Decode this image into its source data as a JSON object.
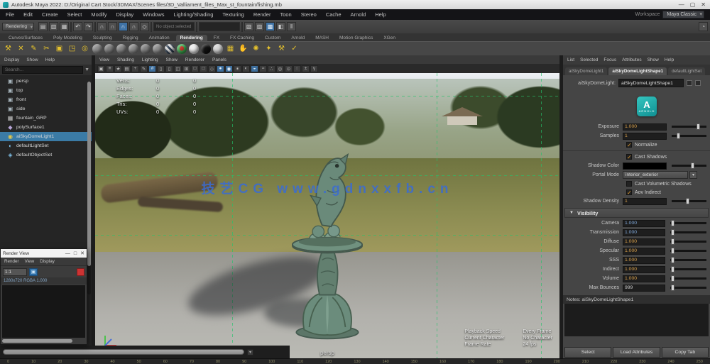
{
  "window": {
    "title": "Autodesk Maya 2022: D:/Original Cart Stock/3DMAX/Scenes files/3D_Valliament_files_Max_st_fountain/fishing.mb",
    "minimize": "—",
    "maximize": "▢",
    "close": "✕"
  },
  "menu_bar": {
    "items": [
      {
        "label": "File"
      },
      {
        "label": "Edit"
      },
      {
        "label": "Create"
      },
      {
        "label": "Select"
      },
      {
        "label": "Modify"
      },
      {
        "label": "Display"
      },
      {
        "label": "Windows"
      },
      {
        "label": "Lighting/Shading"
      },
      {
        "label": "Texturing"
      },
      {
        "label": "Render"
      },
      {
        "label": "Toon"
      },
      {
        "label": "Stereo"
      },
      {
        "label": "Cache"
      },
      {
        "label": "Arnold"
      },
      {
        "label": "Help"
      }
    ],
    "workspace_label": "Workspace",
    "workspace_value": "Maya Classic"
  },
  "status_line": {
    "menu_set": "Rendering",
    "icons": [
      {
        "name": "new-scene-icon",
        "glyph": "▤"
      },
      {
        "name": "open-scene-icon",
        "glyph": "▥"
      },
      {
        "name": "save-scene-icon",
        "glyph": "▦"
      },
      {
        "name": "divider",
        "glyph": "",
        "cls": "divider"
      },
      {
        "name": "undo-icon",
        "glyph": "↶"
      },
      {
        "name": "redo-icon",
        "glyph": "↷"
      },
      {
        "name": "divider",
        "glyph": "",
        "cls": "divider"
      },
      {
        "name": "snap-to-grid-icon",
        "glyph": "∩"
      },
      {
        "name": "snap-to-curve-icon",
        "glyph": "∩"
      },
      {
        "name": "snap-to-point-icon",
        "glyph": "∩",
        "cls": "active"
      },
      {
        "name": "snap-to-plane-icon",
        "glyph": "∩"
      },
      {
        "name": "make-live-icon",
        "glyph": "◇"
      },
      {
        "name": "divider",
        "glyph": "",
        "cls": "divider"
      },
      {
        "name": "input-operations-field",
        "glyph": "No object selected",
        "cls": "field"
      },
      {
        "name": "divider",
        "glyph": "",
        "cls": "divider"
      },
      {
        "name": "output-operations-field",
        "glyph": "",
        "cls": "field"
      },
      {
        "name": "divider",
        "glyph": "",
        "cls": "divider"
      },
      {
        "name": "render-frame-icon",
        "glyph": "▧"
      },
      {
        "name": "ipr-render-icon",
        "glyph": "▨"
      },
      {
        "name": "render-settings-icon",
        "glyph": "▩",
        "cls": "active"
      },
      {
        "name": "display-layers-icon",
        "glyph": "◧"
      },
      {
        "name": "pause-icon",
        "glyph": "‖"
      },
      {
        "name": "spacer",
        "glyph": "",
        "cls": "spacer"
      },
      {
        "name": "sitter-icon",
        "glyph": "◔"
      }
    ]
  },
  "shelf": {
    "tabs": [
      {
        "label": "Curves/Surfaces"
      },
      {
        "label": "Poly Modeling"
      },
      {
        "label": "Sculpting"
      },
      {
        "label": "Rigging"
      },
      {
        "label": "Animation"
      },
      {
        "label": "Rendering",
        "cls": "active"
      },
      {
        "label": "FX"
      },
      {
        "label": "FX Caching"
      },
      {
        "label": "Custom"
      },
      {
        "label": "Arnold"
      },
      {
        "label": "MASH"
      },
      {
        "label": "Motion Graphics"
      },
      {
        "label": "XGen"
      }
    ],
    "icons": [
      {
        "name": "hypershade-icon",
        "glyph": "⚒",
        "cls": "glyph"
      },
      {
        "name": "node-editor-icon",
        "glyph": "✕",
        "cls": "glyph"
      },
      {
        "name": "shading-group-icon",
        "glyph": "✎",
        "cls": "glyph"
      },
      {
        "name": "uv-editor-icon",
        "glyph": "✂",
        "cls": "glyph"
      },
      {
        "name": "material-viewer-icon",
        "glyph": "▣",
        "cls": "glyph"
      },
      {
        "name": "texture-tool-icon",
        "glyph": "◳",
        "cls": "glyph"
      },
      {
        "name": "wrap-tool-icon",
        "glyph": "◎",
        "cls": "glyph"
      },
      {
        "name": "standard-surface-icon",
        "cls": "sphere",
        "style": "background:#8d8d8d"
      },
      {
        "name": "blinn-icon",
        "cls": "sphere",
        "style": "background:#7f7f7f"
      },
      {
        "name": "lambert-icon",
        "cls": "sphere",
        "style": "background:#868686"
      },
      {
        "name": "phong-icon",
        "cls": "sphere",
        "style": "background:#8a8a8a"
      },
      {
        "name": "phonge-icon",
        "cls": "sphere",
        "style": "background:#828282"
      },
      {
        "name": "anisotropic-icon",
        "cls": "sphere",
        "style": "background:#8f8f8f"
      },
      {
        "name": "ramp-shader-icon",
        "cls": "sphere",
        "style": "background:repeating-linear-gradient(45deg,#d8d8d8 0 3px,#2e3e52 3px 6px)"
      },
      {
        "name": "ai-standard-surface-icon",
        "cls": "sphere",
        "style": "background:radial-gradient(circle at 50% 45%,#c03a2e 0 30%,#3faf52 32%)"
      },
      {
        "name": "surface-shader-icon",
        "cls": "sphere",
        "style": "background:#ededed"
      },
      {
        "name": "shadow-matte-icon",
        "cls": "sphere",
        "style": "background:#111"
      },
      {
        "name": "ai-mix-shader-icon",
        "cls": "sphere",
        "style": "background:#d6d6d6"
      },
      {
        "name": "ai-standard-volume-icon",
        "glyph": "▦",
        "cls": "glyph"
      },
      {
        "name": "assign-material-icon",
        "glyph": "✋",
        "cls": "glyph"
      },
      {
        "name": "point-light-icon",
        "glyph": "✺",
        "cls": "glyph"
      },
      {
        "name": "spot-light-icon",
        "glyph": "✦",
        "cls": "glyph"
      },
      {
        "name": "area-light-icon",
        "glyph": "⚒",
        "cls": "glyph"
      },
      {
        "name": "render-view-icon",
        "glyph": "✓",
        "cls": "glyph"
      }
    ]
  },
  "outliner": {
    "menus": [
      {
        "label": "Display"
      },
      {
        "label": "Show"
      },
      {
        "label": "Help"
      }
    ],
    "search_placeholder": "Search...",
    "items": [
      {
        "g": "▣",
        "ic": "cam",
        "label": "persp"
      },
      {
        "g": "▣",
        "ic": "cam",
        "label": "top"
      },
      {
        "g": "▣",
        "ic": "cam",
        "label": "front"
      },
      {
        "g": "▣",
        "ic": "cam",
        "label": "side"
      },
      {
        "g": "▦",
        "ic": "grp",
        "label": "fountain_GRP"
      },
      {
        "g": "◆",
        "ic": "mesh",
        "label": "polySurface1"
      },
      {
        "g": "◉",
        "ic": "light",
        "label": "aiSkyDomeLight1",
        "cls": "selected"
      },
      {
        "g": "◐",
        "ic": "set",
        "label": "defaultLightSet"
      },
      {
        "g": "◈",
        "ic": "set",
        "label": "defaultObjectSet"
      }
    ]
  },
  "render_view": {
    "title": "Render View",
    "controls": {
      "minimize": "—",
      "maximize": "□",
      "close": "✕"
    },
    "menus": [
      {
        "label": "Render"
      },
      {
        "label": "View"
      },
      {
        "label": "Display"
      }
    ],
    "zoom_value": "1:1",
    "info": "1280x720  RGBA  1.000"
  },
  "viewport": {
    "menus": [
      {
        "label": "View"
      },
      {
        "label": "Shading"
      },
      {
        "label": "Lighting"
      },
      {
        "label": "Show"
      },
      {
        "label": "Renderer"
      },
      {
        "label": "Panels"
      }
    ],
    "toolbar_icons": [
      {
        "name": "select-camera-icon",
        "glyph": "▣"
      },
      {
        "name": "camera-attributes-icon",
        "glyph": "≡"
      },
      {
        "name": "bookmark-icon",
        "glyph": "★"
      },
      {
        "name": "image-plane-icon",
        "glyph": "▤"
      },
      {
        "name": "2d-pan-zoom-icon",
        "glyph": "+"
      },
      {
        "name": "grease-pencil-icon",
        "glyph": "✎"
      },
      {
        "name": "grid-icon",
        "glyph": "#",
        "cls": "active"
      },
      {
        "name": "film-gate-icon",
        "glyph": "▯"
      },
      {
        "name": "resolution-gate-icon",
        "glyph": "▯"
      },
      {
        "name": "gate-mask-icon",
        "glyph": "◫"
      },
      {
        "name": "field-chart-icon",
        "glyph": "⊞"
      },
      {
        "name": "safe-action-icon",
        "glyph": "□"
      },
      {
        "name": "safe-title-icon",
        "glyph": "□"
      },
      {
        "name": "wireframe-icon",
        "glyph": "◇"
      },
      {
        "name": "shaded-icon",
        "glyph": "●",
        "cls": "active"
      },
      {
        "name": "textured-icon",
        "glyph": "◉",
        "cls": "active"
      },
      {
        "name": "use-all-lights-icon",
        "glyph": "✶"
      },
      {
        "name": "shadows-icon",
        "glyph": "◐"
      },
      {
        "name": "screen-space-ao-icon",
        "glyph": "◒",
        "cls": "active"
      },
      {
        "name": "motion-blur-icon",
        "glyph": "≈"
      },
      {
        "name": "multisample-icon",
        "glyph": "∴"
      },
      {
        "name": "depth-of-field-icon",
        "glyph": "◎"
      },
      {
        "name": "isolate-select-icon",
        "glyph": "⊙"
      },
      {
        "name": "xray-icon",
        "glyph": "◌"
      },
      {
        "name": "exposure-icon",
        "glyph": "±"
      },
      {
        "name": "gamma-icon",
        "glyph": "γ"
      }
    ],
    "hud_poly": [
      {
        "label": "Verts:",
        "total": "0",
        "sel": "0"
      },
      {
        "label": "Edges:",
        "total": "0",
        "sel": "0"
      },
      {
        "label": "Faces:",
        "total": "0",
        "sel": "0"
      },
      {
        "label": "Tris:",
        "total": "0",
        "sel": "0"
      },
      {
        "label": "UVs:",
        "total": "0",
        "sel": "0"
      }
    ],
    "watermark": "技艺CG  www.gdnxxfb.cn",
    "hud_bottom": [
      {
        "k": "Playback Speed",
        "v": "Every Frame"
      },
      {
        "k": "Current Character",
        "v": "No Character"
      },
      {
        "k": "Frame Rate",
        "v": "24 fps"
      }
    ],
    "camera_label": "persp"
  },
  "ae": {
    "menus": [
      {
        "label": "List"
      },
      {
        "label": "Selected"
      },
      {
        "label": "Focus"
      },
      {
        "label": "Attributes"
      },
      {
        "label": "Show"
      },
      {
        "label": "Help"
      }
    ],
    "tabs": [
      {
        "label": "aiSkyDomeLight1"
      },
      {
        "label": "aiSkyDomeLightShape1",
        "cls": "active"
      },
      {
        "label": "defaultLightSet"
      }
    ],
    "name_label": "aiSkyDomeLight:",
    "name_value": "aiSkyDomeLightShape1",
    "arnold_letter": "A",
    "arnold_sub": "ARNOLD",
    "rows": {
      "exposure_label": "Exposure",
      "exposure_value": "1.000",
      "samples_label": "Samples",
      "samples_value": "1",
      "normalize_label": "Normalize",
      "cast_shadows_label": "Cast Shadows",
      "shadow_color_label": "Shadow Color",
      "portal_mode_label": "Portal Mode",
      "portal_mode_value": "interior_exterior",
      "cast_vol_label": "Cast Volumetric Shadows",
      "aov_indirect_label": "Aov Indirect",
      "shadow_density_label": "Shadow Density",
      "shadow_density_value": "1",
      "check_glyph": "✓"
    },
    "visibility": {
      "header": "Visibility",
      "rows": [
        {
          "label": "Camera",
          "value": "1.000",
          "tone": "tblue"
        },
        {
          "label": "Transmission",
          "value": "1.000",
          "tone": "tblue"
        },
        {
          "label": "Diffuse",
          "value": "1.000",
          "tone": "torange"
        },
        {
          "label": "Specular",
          "value": "1.000",
          "tone": "torange"
        },
        {
          "label": "SSS",
          "value": "1.000",
          "tone": "torange"
        },
        {
          "label": "Indirect",
          "value": "1.000",
          "tone": "torange"
        },
        {
          "label": "Volume",
          "value": "1.000",
          "tone": "torange"
        },
        {
          "label": "Max Bounces",
          "value": "999",
          "tone": "tgray"
        }
      ]
    },
    "notes_header": "Notes: aiSkyDomeLightShape1",
    "buttons": [
      {
        "label": "Select"
      },
      {
        "label": "Load Attributes"
      },
      {
        "label": "Copy Tab"
      }
    ]
  },
  "bottom": {
    "ticks": [
      "0",
      "10",
      "20",
      "30",
      "40",
      "50",
      "60",
      "70",
      "80",
      "90",
      "100",
      "110",
      "120",
      "130",
      "140",
      "150",
      "160",
      "170",
      "180",
      "190",
      "200",
      "210",
      "220",
      "230",
      "240",
      "250"
    ]
  },
  "colors": {
    "accent_blue": "#3b7ba6",
    "value_orange": "#d9a04a",
    "value_blue": "#7fa8d9",
    "watermark_blue": "#3a6cd4",
    "arnold_teal": "#19a3a8",
    "verdigris": "#6b8c7e"
  }
}
